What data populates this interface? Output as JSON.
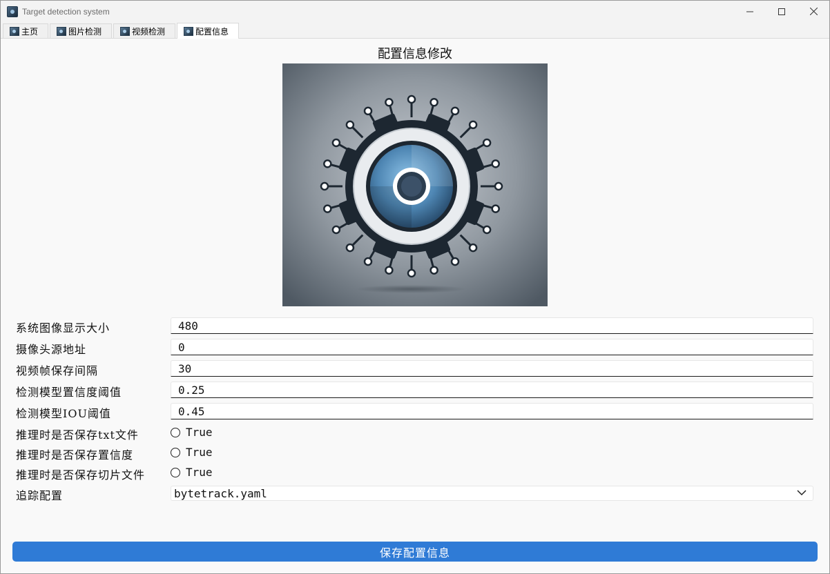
{
  "window": {
    "title": "Target detection system",
    "controls": [
      "minimize",
      "maximize",
      "close"
    ]
  },
  "tabs": [
    {
      "label": "主页",
      "icon": "app-logo-icon"
    },
    {
      "label": "图片检测",
      "icon": "app-logo-icon"
    },
    {
      "label": "视频检测",
      "icon": "app-logo-icon"
    },
    {
      "label": "配置信息",
      "icon": "app-logo-icon",
      "active": true
    }
  ],
  "page": {
    "title": "配置信息修改",
    "image": "settings-gear-circuit-illustration"
  },
  "settings": {
    "display_size": {
      "label": "系统图像显示大小",
      "value": "480"
    },
    "camera_source": {
      "label": "摄像头源地址",
      "value": "0"
    },
    "frame_interval": {
      "label": "视频帧保存间隔",
      "value": "30"
    },
    "confidence": {
      "label": "检测模型置信度阈值",
      "value": "0.25"
    },
    "iou": {
      "label": "检测模型IOU阈值",
      "value": "0.45"
    },
    "save_txt": {
      "label": "推理时是否保存txt文件",
      "option": "True",
      "checked": false
    },
    "save_conf": {
      "label": "推理时是否保存置信度",
      "option": "True",
      "checked": false
    },
    "save_crop": {
      "label": "推理时是否保存切片文件",
      "option": "True",
      "checked": false
    },
    "tracker": {
      "label": "追踪配置",
      "value": "bytetrack.yaml"
    }
  },
  "buttons": {
    "save": "保存配置信息"
  },
  "colors": {
    "accent": "#2f7bd6",
    "window_bg": "#f9f9f9"
  }
}
